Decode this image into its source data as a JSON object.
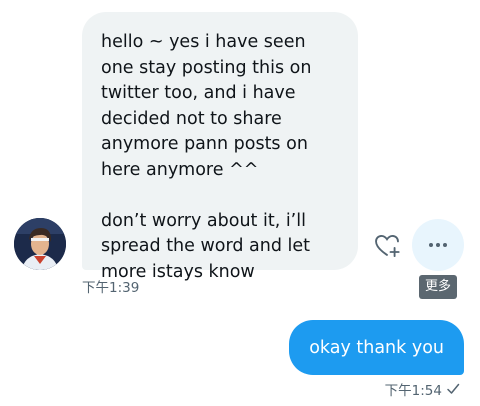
{
  "incoming_message": {
    "paragraphs": [
      "hello ~ yes i have seen one stay posting this on twitter too, and i have decided not to share anymore pann posts on here anymore ^^",
      "don’t worry about it, i’ll spread the word and let more istays know"
    ],
    "timestamp": "下午1:39"
  },
  "actions": {
    "react_icon": "heart-plus-icon",
    "more_icon": "more-horizontal-icon",
    "more_tooltip": "更多"
  },
  "outgoing_message": {
    "text": "okay thank you",
    "timestamp": "下午1:54",
    "status_icon": "checkmark-icon"
  },
  "colors": {
    "incoming_bubble": "#eff3f4",
    "outgoing_bubble": "#1d9bf0",
    "more_button_bg": "#e8f5fd",
    "secondary_text": "#536471",
    "tooltip_bg": "#5b6770"
  }
}
